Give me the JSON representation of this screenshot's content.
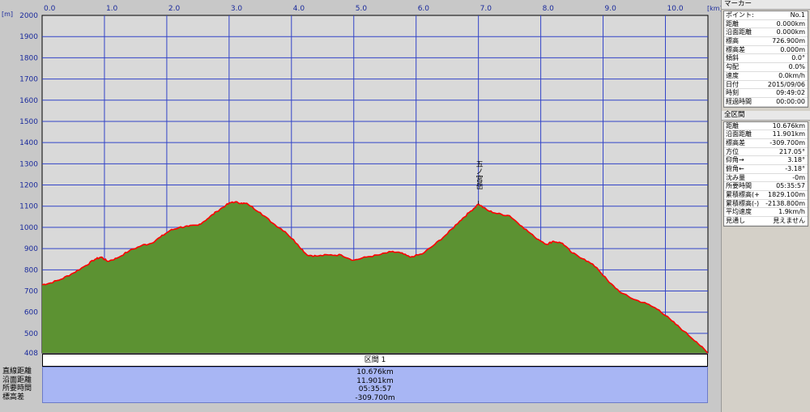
{
  "chart_data": {
    "type": "area",
    "x_unit_label": "[km]",
    "y_unit_label": "[m]",
    "xlim": [
      0,
      10.676
    ],
    "ylim": [
      408,
      2000
    ],
    "x_ticks": [
      "0.0",
      "1.0",
      "2.0",
      "3.0",
      "4.0",
      "5.0",
      "6.0",
      "7.0",
      "8.0",
      "9.0",
      "10.0"
    ],
    "y_ticks": [
      "2000",
      "1900",
      "1800",
      "1700",
      "1600",
      "1500",
      "1400",
      "1300",
      "1200",
      "1100",
      "1000",
      "900",
      "800",
      "700",
      "600",
      "500",
      "408"
    ],
    "grid": true,
    "fill_color": "#5c9232",
    "line_color": "#ff0000",
    "x": [
      0,
      0.1,
      0.3,
      0.5,
      0.7,
      0.85,
      0.95,
      1.05,
      1.2,
      1.4,
      1.6,
      1.75,
      1.9,
      2.05,
      2.2,
      2.35,
      2.5,
      2.65,
      2.8,
      2.95,
      3.05,
      3.2,
      3.3,
      3.5,
      3.7,
      3.9,
      4.1,
      4.25,
      4.4,
      4.6,
      4.8,
      5.0,
      5.2,
      5.4,
      5.6,
      5.75,
      5.9,
      6.1,
      6.3,
      6.5,
      6.7,
      6.85,
      7.0,
      7.15,
      7.3,
      7.5,
      7.7,
      7.9,
      8.1,
      8.2,
      8.35,
      8.5,
      8.7,
      8.9,
      9.1,
      9.3,
      9.5,
      9.7,
      9.9,
      10.1,
      10.3,
      10.5,
      10.676
    ],
    "y": [
      730,
      735,
      755,
      785,
      820,
      850,
      860,
      840,
      855,
      890,
      915,
      925,
      955,
      985,
      1000,
      1005,
      1010,
      1040,
      1075,
      1105,
      1120,
      1115,
      1110,
      1070,
      1020,
      980,
      920,
      870,
      865,
      870,
      870,
      845,
      860,
      870,
      885,
      880,
      860,
      875,
      920,
      970,
      1030,
      1070,
      1110,
      1080,
      1065,
      1055,
      1005,
      955,
      920,
      935,
      925,
      880,
      850,
      810,
      740,
      690,
      660,
      640,
      610,
      560,
      510,
      460,
      408
    ],
    "annotations": [
      {
        "x": 7.0,
        "y": 1110,
        "text": "五ノ宮岳"
      }
    ]
  },
  "section": {
    "header": "区間 1",
    "labels": [
      "直線距離",
      "沿面距離",
      "所要時間",
      "標高差"
    ],
    "values": [
      "10.676km",
      "11.901km",
      "05:35:57",
      "-309.700m"
    ]
  },
  "panel": {
    "marker_title": "マーカー",
    "marker_rows": [
      {
        "k": "ポイント:",
        "v": "No.1"
      },
      {
        "k": "距離",
        "v": "0.000km"
      },
      {
        "k": "沿面距離",
        "v": "0.000km"
      },
      {
        "k": "標高",
        "v": "726.900m"
      },
      {
        "k": "標高差",
        "v": "0.000m"
      },
      {
        "k": "傾斜",
        "v": "0.0°"
      },
      {
        "k": "勾配",
        "v": "0.0%"
      },
      {
        "k": "速度",
        "v": "0.0km/h"
      },
      {
        "k": "日付",
        "v": "2015/09/06"
      },
      {
        "k": "時刻",
        "v": "09:49:02"
      },
      {
        "k": "経過時間",
        "v": "00:00:00"
      }
    ],
    "all_title": "全区間",
    "all_rows": [
      {
        "k": "距離",
        "v": "10.676km"
      },
      {
        "k": "沿面距離",
        "v": "11.901km"
      },
      {
        "k": "標高差",
        "v": "-309.700m"
      },
      {
        "k": "方位",
        "v": "217.05°"
      },
      {
        "k": "仰角→",
        "v": "3.18°"
      },
      {
        "k": "俯角←",
        "v": "-3.18°"
      },
      {
        "k": "沈み量",
        "v": "-0m"
      },
      {
        "k": "所要時間",
        "v": "05:35:57"
      },
      {
        "k": "累積標高(+)",
        "v": "1829.100m"
      },
      {
        "k": "累積標高(-)",
        "v": "-2138.800m"
      },
      {
        "k": "平均速度",
        "v": "1.9km/h"
      },
      {
        "k": "見通し",
        "v": "見えません"
      }
    ]
  }
}
